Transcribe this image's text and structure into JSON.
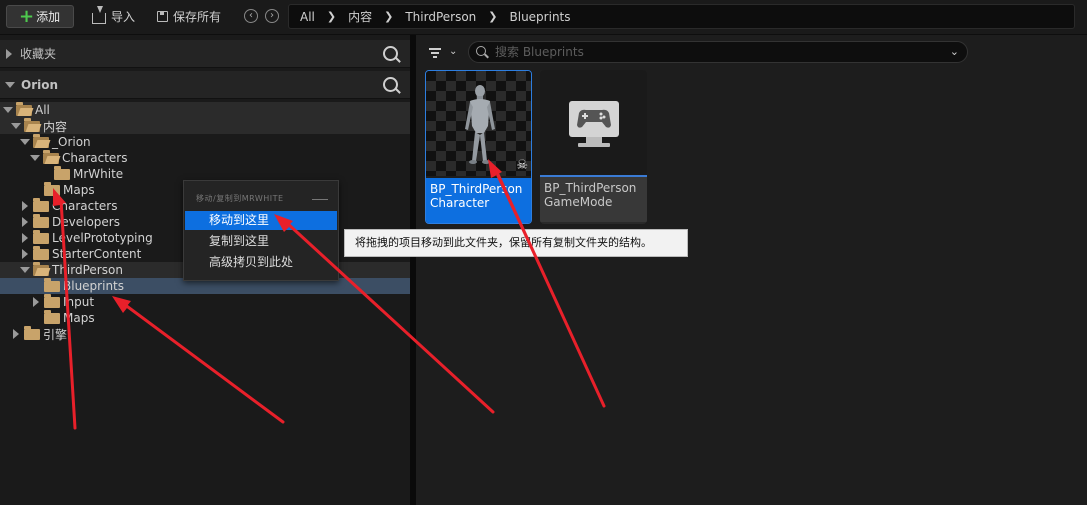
{
  "toolbar": {
    "add_label": "添加",
    "import_label": "导入",
    "save_all_label": "保存所有"
  },
  "breadcrumb": [
    "All",
    "内容",
    "ThirdPerson",
    "Blueprints"
  ],
  "left_panel": {
    "favorites_title": "收藏夹",
    "project_title": "Orion",
    "tree": [
      {
        "label": "All",
        "expanded": true
      },
      {
        "label": "内容",
        "expanded": true
      },
      {
        "label": "_Orion",
        "expanded": true
      },
      {
        "label": "Characters",
        "expanded": true
      },
      {
        "label": "MrWhite",
        "expanded": false
      },
      {
        "label": "Maps",
        "expanded": false
      },
      {
        "label": "Characters",
        "expanded": false
      },
      {
        "label": "Developers",
        "expanded": false
      },
      {
        "label": "LevelPrototyping",
        "expanded": false
      },
      {
        "label": "StarterContent",
        "expanded": false
      },
      {
        "label": "ThirdPerson",
        "expanded": true
      },
      {
        "label": "Blueprints",
        "expanded": false,
        "selected": true
      },
      {
        "label": "Input",
        "expanded": false
      },
      {
        "label": "Maps",
        "expanded": false
      },
      {
        "label": "引擎",
        "expanded": false
      }
    ]
  },
  "right_panel": {
    "search_placeholder": "搜索 Blueprints",
    "assets": [
      {
        "name_line1": "BP_ThirdPerson",
        "name_line2": "Character",
        "selected": true
      },
      {
        "name_line1": "BP_ThirdPerson",
        "name_line2": "GameMode",
        "selected": false
      }
    ]
  },
  "context_menu": {
    "header": "移动/复制到MRWHITE",
    "items": [
      "移动到这里",
      "复制到这里",
      "高级拷贝到此处"
    ],
    "active_index": 0
  },
  "tooltip": {
    "text": "将拖拽的项目移动到此文件夹，保留所有复制文件夹的结构。"
  },
  "colors": {
    "accent": "#0d6fe0",
    "folder": "#c8a36a",
    "annotation_arrow": "#e8202a",
    "add_plus": "#4ec94e"
  }
}
